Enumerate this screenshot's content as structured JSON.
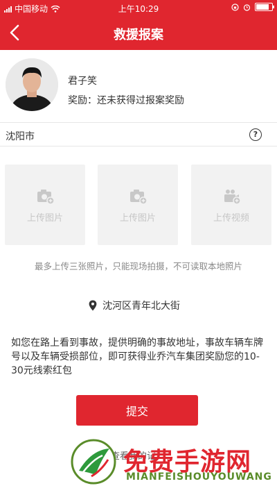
{
  "status_bar": {
    "carrier": "中国移动",
    "time": "上午10:29"
  },
  "header": {
    "title": "救援报案"
  },
  "profile": {
    "name": "君子笑",
    "reward_text": "奖励：还未获得过报案奖励"
  },
  "city": {
    "label": "沈阳市"
  },
  "uploads": [
    {
      "label": "上传图片",
      "icon": "camera-plus-icon"
    },
    {
      "label": "上传图片",
      "icon": "camera-plus-icon"
    },
    {
      "label": "上传视频",
      "icon": "video-plus-icon"
    }
  ],
  "upload_tip": "最多上传三张照片，只能现场拍摄，不可读取本地照片",
  "location": {
    "text": "沈河区青年北大街"
  },
  "description": "如您在路上看到事故，提供明确的事故地址，事故车辆车牌号以及车辆受损部位，即可获得业乔汽车集团奖励您的10-30元线索红包",
  "submit_label": "提交",
  "link_partial": "查看我的记",
  "watermark": {
    "main": "免费手游网",
    "sub": "MIANFEISHOUYOUWANG"
  },
  "colors": {
    "primary": "#e0262f",
    "placeholder_bg": "#f2f2f2",
    "placeholder_text": "#c6c6c6"
  }
}
